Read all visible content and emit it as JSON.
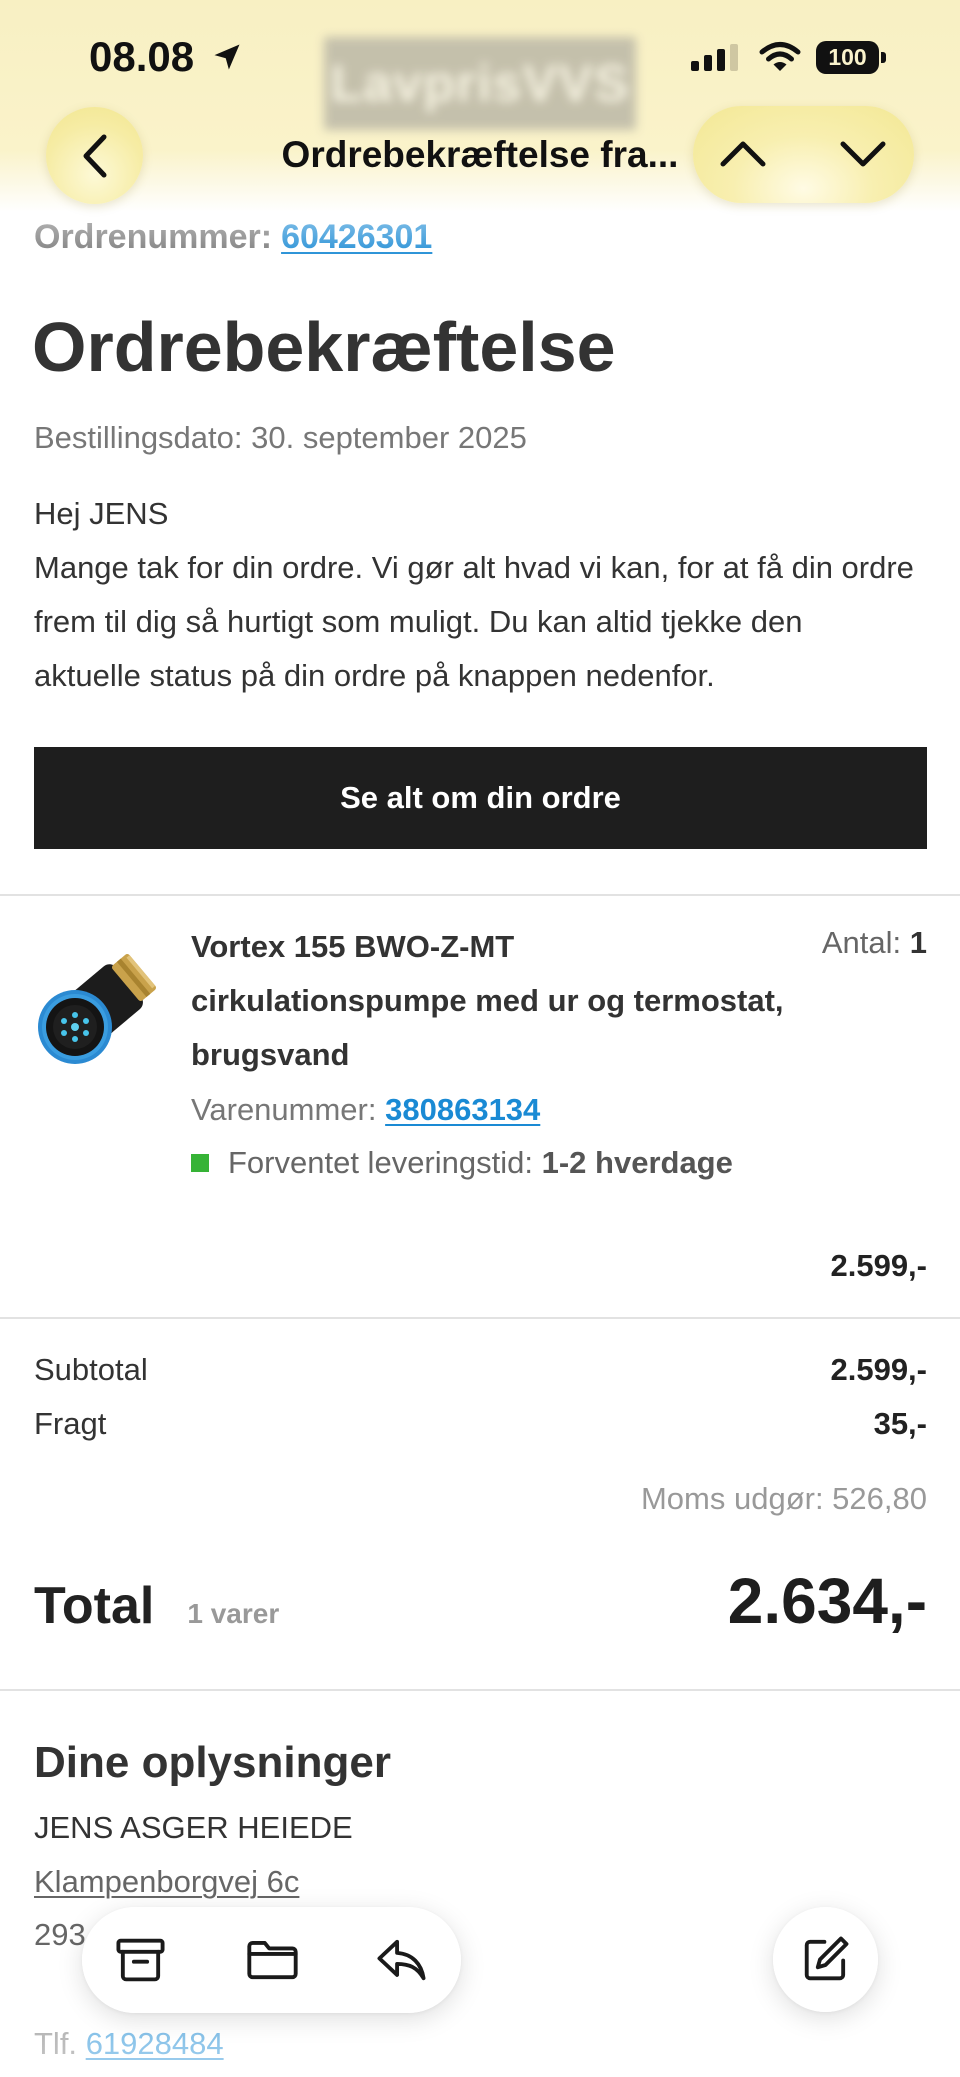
{
  "status_bar": {
    "time": "08.08",
    "battery_level": "100",
    "icons": {
      "location": "location-arrow-icon",
      "signal": "cellular-signal-icon",
      "wifi": "wifi-icon",
      "battery": "battery-icon"
    }
  },
  "header": {
    "logo_text": "LavprisVVS",
    "title": "Ordrebekræftelse fra...",
    "icons": {
      "back": "chevron-left-icon",
      "previous": "chevron-up-icon",
      "next": "chevron-down-icon"
    }
  },
  "email": {
    "order_number_label": "Ordrenummer:",
    "order_number": "60426301",
    "heading": "Ordrebekræftelse",
    "order_date": "Bestillingsdato: 30. september 2025",
    "greeting": "Hej JENS",
    "message_lines": [
      "Mange tak for din ordre. Vi gør alt hvad vi kan, for at få din ordre",
      "frem til dig så hurtigt som muligt. Du kan altid tjekke den",
      "aktuelle status på din ordre på knappen nedenfor."
    ],
    "cta_label": "Se alt om din ordre"
  },
  "order_item": {
    "image_icon": "circulation-pump-image",
    "name_lines": [
      "Vortex 155 BWO-Z-MT",
      "cirkulationspumpe med ur og termostat,",
      "brugsvand"
    ],
    "quantity_label": "Antal:",
    "quantity": "1",
    "sku_label": "Varenummer:",
    "sku": "380863134",
    "delivery_label": "Forventet leveringstid:",
    "delivery_time": "1-2 hverdage",
    "price": "2.599,-"
  },
  "totals": {
    "subtotal_label": "Subtotal",
    "subtotal": "2.599,-",
    "shipping_label": "Fragt",
    "shipping": "35,-",
    "vat": "Moms udgør: 526,80",
    "total_label": "Total",
    "item_count": "1 varer",
    "total": "2.634,-"
  },
  "customer": {
    "heading": "Dine oplysninger",
    "name": "JENS ASGER HEIEDE",
    "street": "Klampenborgvej 6c",
    "postal": "293",
    "phone_label": "Tlf.",
    "phone": "61928484"
  },
  "toolbar": {
    "icons": [
      "archive-icon",
      "folder-icon",
      "reply-icon",
      "compose-icon"
    ]
  },
  "colors": {
    "header_yellow": "#f8f0c3",
    "link_blue": "#1a8ad4",
    "button_black": "#1e1e1e",
    "text_dark": "#333333",
    "text_muted": "#777777",
    "delivery_status_green": "#36b336"
  }
}
